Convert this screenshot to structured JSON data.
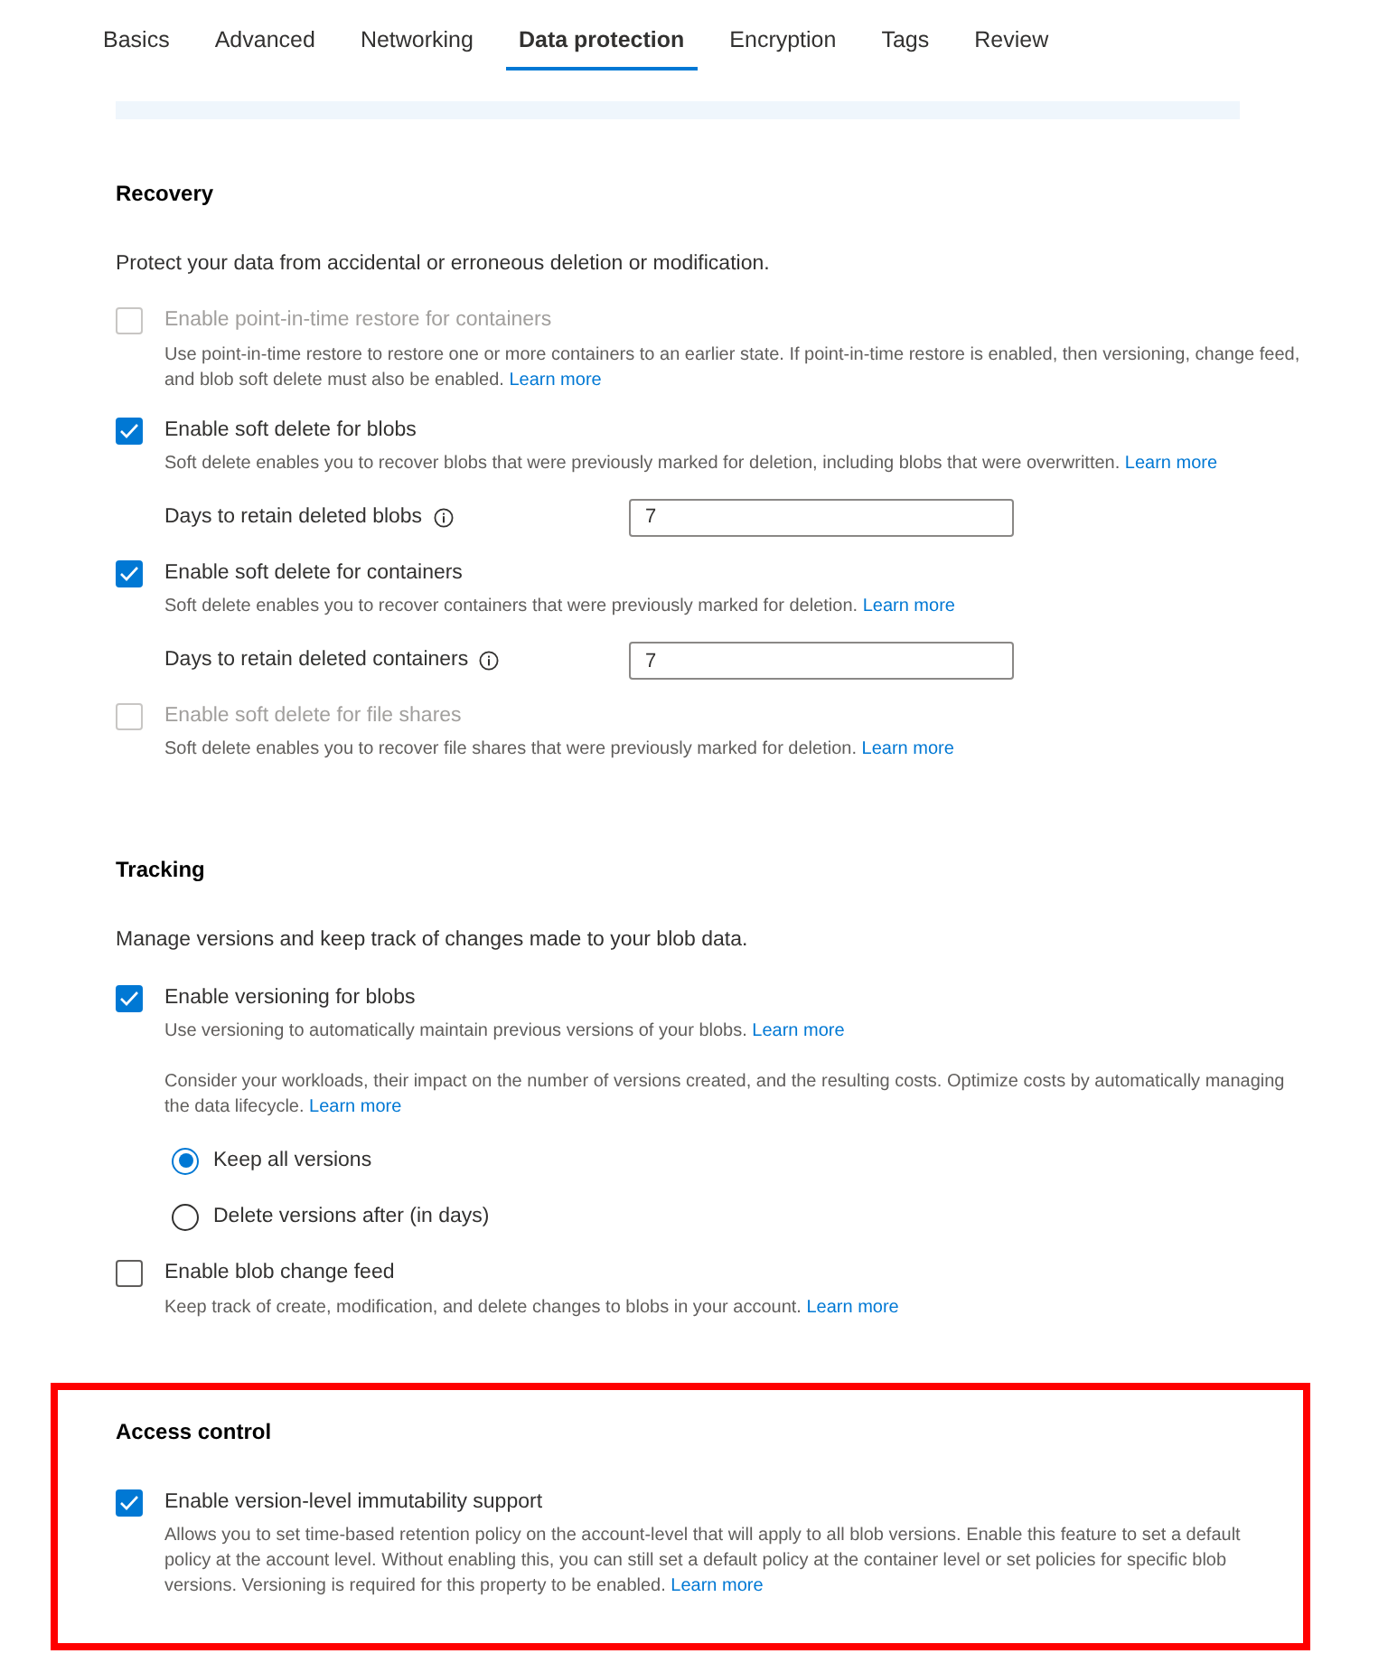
{
  "tabs": [
    {
      "label": "Basics",
      "selected": false
    },
    {
      "label": "Advanced",
      "selected": false
    },
    {
      "label": "Networking",
      "selected": false
    },
    {
      "label": "Data protection",
      "selected": true
    },
    {
      "label": "Encryption",
      "selected": false
    },
    {
      "label": "Tags",
      "selected": false
    },
    {
      "label": "Review",
      "selected": false
    }
  ],
  "sections": [
    {
      "title": "Recovery",
      "highlighted": false,
      "description": "Protect your data from accidental or erroneous deletion or modification.",
      "items": [
        {
          "kind": "checkbox",
          "label": "Enable point-in-time restore for containers",
          "checked": false,
          "disabled": true,
          "description": "Use point-in-time restore to restore one or more containers to an earlier state. If point-in-time restore is enabled, then versioning, change feed, and blob soft delete must also be enabled.",
          "link": "Learn more"
        },
        {
          "kind": "checkbox",
          "label": "Enable soft delete for blobs",
          "checked": true,
          "disabled": false,
          "description": "Soft delete enables you to recover blobs that were previously marked for deletion, including blobs that were overwritten.",
          "link": "Learn more"
        },
        {
          "kind": "field",
          "label": "Days to retain deleted blobs",
          "value": "7"
        },
        {
          "kind": "checkbox",
          "label": "Enable soft delete for containers",
          "checked": true,
          "disabled": false,
          "description": "Soft delete enables you to recover containers that were previously marked for deletion.",
          "link": "Learn more"
        },
        {
          "kind": "field",
          "label": "Days to retain deleted containers",
          "value": "7"
        },
        {
          "kind": "checkbox",
          "label": "Enable soft delete for file shares",
          "checked": false,
          "disabled": true,
          "description": "Soft delete enables you to recover file shares that were previously marked for deletion.",
          "link": "Learn more"
        }
      ]
    },
    {
      "title": "Tracking",
      "highlighted": false,
      "description": "Manage versions and keep track of changes made to your blob data.",
      "items": [
        {
          "kind": "checkbox",
          "label": "Enable versioning for blobs",
          "checked": true,
          "disabled": false,
          "description": "Use versioning to automatically maintain previous versions of your blobs.",
          "link": "Learn more"
        },
        {
          "kind": "note",
          "text": "Consider your workloads, their impact on the number of versions created, and the resulting costs. Optimize costs by automatically managing the data lifecycle.",
          "link": "Learn more"
        },
        {
          "kind": "radio",
          "label": "Keep all versions",
          "selected": true
        },
        {
          "kind": "radio",
          "label": "Delete versions after (in days)",
          "selected": false
        },
        {
          "kind": "checkbox",
          "label": "Enable blob change feed",
          "checked": false,
          "disabled": false,
          "description": "Keep track of create, modification, and delete changes to blobs in your account.",
          "link": "Learn more"
        }
      ]
    },
    {
      "title": "Access control",
      "highlighted": true,
      "items": [
        {
          "kind": "checkbox",
          "label": "Enable version-level immutability support",
          "checked": true,
          "disabled": false,
          "description": "Allows you to set time-based retention policy on the account-level that will apply to all blob versions. Enable this feature to set a default policy at the account level. Without enabling this, you can still set a default policy at the container level or set policies for specific blob versions. Versioning is required for this property to be enabled.",
          "link": "Learn more"
        }
      ]
    }
  ]
}
